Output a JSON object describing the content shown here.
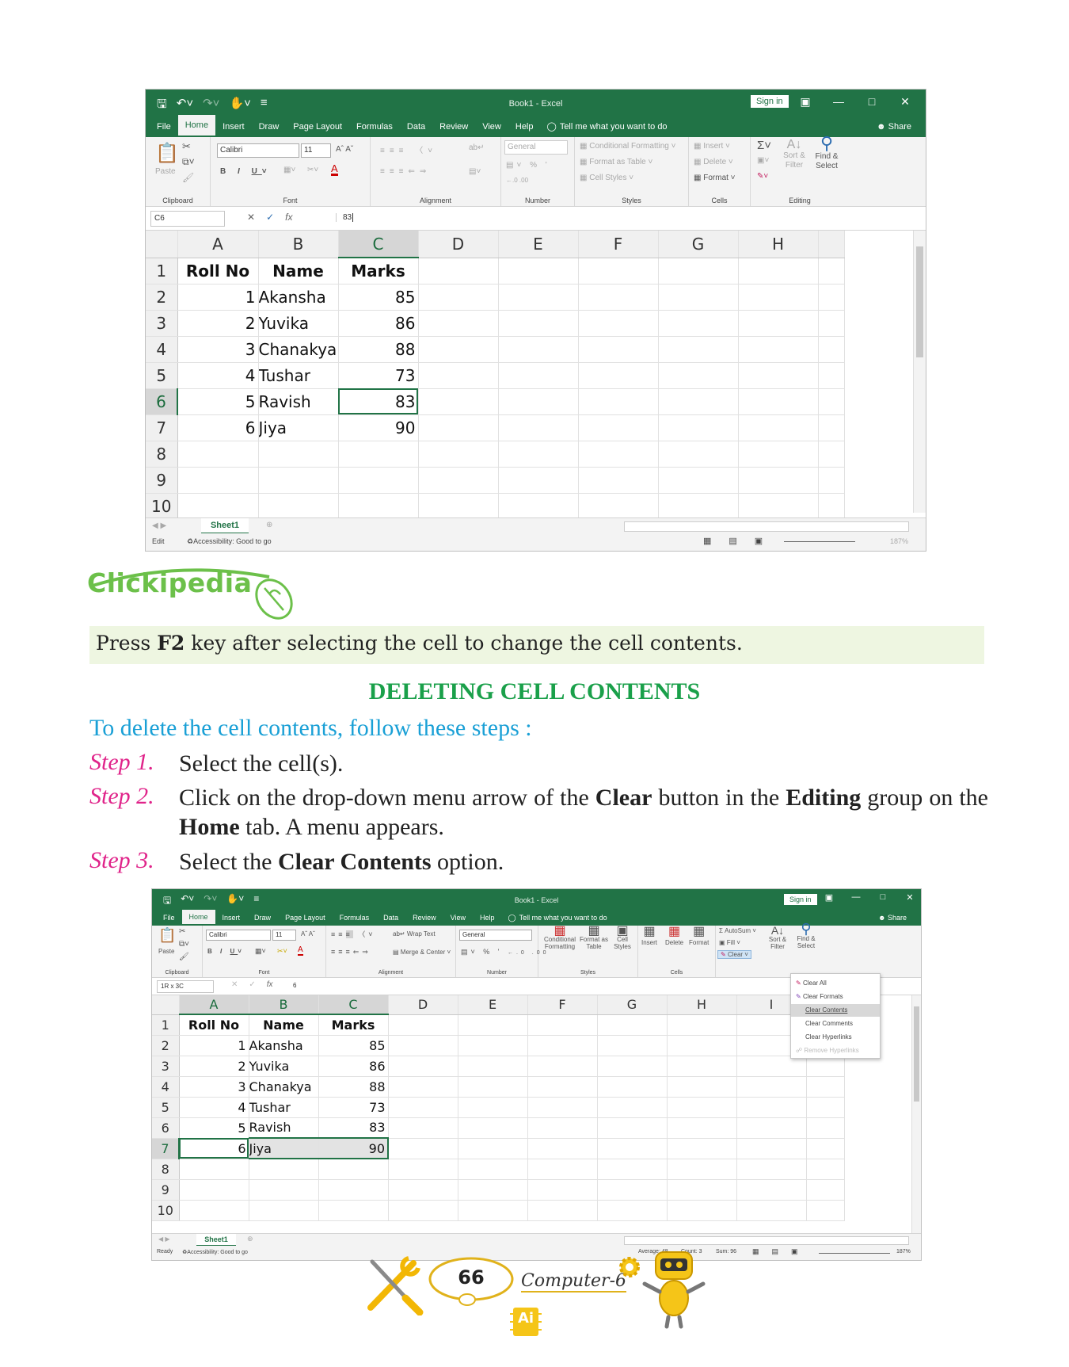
{
  "excel1": {
    "qat_icons": [
      "save-icon",
      "undo-icon",
      "redo-icon",
      "touch-icon",
      "customize-icon"
    ],
    "title": "Book1  -  Excel",
    "sign_in": "Sign in",
    "tabs": [
      "File",
      "Home",
      "Insert",
      "Draw",
      "Page Layout",
      "Formulas",
      "Data",
      "Review",
      "View",
      "Help"
    ],
    "active_tab": "Home",
    "tell_me": "Tell me what you want to do",
    "share": "Share",
    "groups": {
      "clipboard": "Clipboard",
      "font": "Font",
      "alignment": "Alignment",
      "number": "Number",
      "styles": "Styles",
      "cells": "Cells",
      "editing": "Editing"
    },
    "paste": "Paste",
    "font_name": "Calibri",
    "font_size": "11",
    "number_format": "General",
    "cond_format": "Conditional Formatting",
    "format_table": "Format as Table",
    "cell_styles": "Cell Styles",
    "insert": "Insert",
    "delete": "Delete",
    "format": "Format",
    "sort_filter": "Sort & Filter",
    "find_select": "Find & Select",
    "name_box": "C6",
    "formula": "83",
    "columns": [
      "A",
      "B",
      "C",
      "D",
      "E",
      "F",
      "G",
      "H"
    ],
    "rows": [
      {
        "n": "1",
        "a": "Roll No",
        "b": "Name",
        "c": "Marks"
      },
      {
        "n": "2",
        "a": "1",
        "b": "Akansha",
        "c": "85"
      },
      {
        "n": "3",
        "a": "2",
        "b": "Yuvika",
        "c": "86"
      },
      {
        "n": "4",
        "a": "3",
        "b": "Chanakya",
        "c": "88"
      },
      {
        "n": "5",
        "a": "4",
        "b": "Tushar",
        "c": "73"
      },
      {
        "n": "6",
        "a": "5",
        "b": "Ravish",
        "c": "83"
      },
      {
        "n": "7",
        "a": "6",
        "b": "Jiya",
        "c": "90"
      },
      {
        "n": "8",
        "a": "",
        "b": "",
        "c": ""
      },
      {
        "n": "9",
        "a": "",
        "b": "",
        "c": ""
      },
      {
        "n": "10",
        "a": "",
        "b": "",
        "c": ""
      }
    ],
    "sheet": "Sheet1",
    "status_mode": "Edit",
    "accessibility": "Accessibility: Good to go",
    "zoom": "187%"
  },
  "clickipedia": {
    "title": "Clickipedia",
    "text_pre": "Press ",
    "text_key": "F2",
    "text_post": " key after selecting the cell to change the cell contents."
  },
  "section": {
    "heading": "DELETING CELL CONTENTS",
    "intro": "To delete the cell contents, follow these steps :",
    "steps": [
      {
        "label": "Step 1.",
        "parts": [
          "Select the cell(s)."
        ]
      },
      {
        "label": "Step 2.",
        "parts": [
          "Click on the drop-down menu arrow of the ",
          "Clear",
          " button in the ",
          "Editing",
          " group on the ",
          "Home",
          " tab. A menu appears."
        ]
      },
      {
        "label": "Step 3.",
        "parts": [
          "Select the ",
          "Clear Contents",
          " option."
        ]
      }
    ]
  },
  "excel2": {
    "title": "Book1  -  Excel",
    "sign_in": "Sign in",
    "tabs": [
      "File",
      "Home",
      "Insert",
      "Draw",
      "Page Layout",
      "Formulas",
      "Data",
      "Review",
      "View",
      "Help"
    ],
    "tell_me": "Tell me what you want to do",
    "share": "Share",
    "groups": {
      "clipboard": "Clipboard",
      "font": "Font",
      "alignment": "Alignment",
      "number": "Number",
      "styles": "Styles",
      "cells": "Cells"
    },
    "paste": "Paste",
    "font_name": "Calibri",
    "font_size": "11",
    "wrap_text": "Wrap Text",
    "merge_center": "Merge & Center",
    "number_format": "General",
    "cond_format": "Conditional Formatting",
    "format_table": "Format as Table",
    "cell_styles": "Cell Styles",
    "insert": "Insert",
    "delete": "Delete",
    "format": "Format",
    "autosum": "AutoSum",
    "fill": "Fill",
    "clear": "Clear",
    "sort_filter": "Sort & Filter",
    "find_select": "Find & Select",
    "clear_menu": [
      "Clear All",
      "Clear Formats",
      "Clear Contents",
      "Clear Comments",
      "Clear Hyperlinks",
      "Remove Hyperlinks"
    ],
    "name_box": "1R x 3C",
    "formula": "6",
    "columns": [
      "A",
      "B",
      "C",
      "D",
      "E",
      "F",
      "G",
      "H",
      "I",
      "J"
    ],
    "rows": [
      {
        "n": "1",
        "a": "Roll No",
        "b": "Name",
        "c": "Marks"
      },
      {
        "n": "2",
        "a": "1",
        "b": "Akansha",
        "c": "85"
      },
      {
        "n": "3",
        "a": "2",
        "b": "Yuvika",
        "c": "86"
      },
      {
        "n": "4",
        "a": "3",
        "b": "Chanakya",
        "c": "88"
      },
      {
        "n": "5",
        "a": "4",
        "b": "Tushar",
        "c": "73"
      },
      {
        "n": "6",
        "a": "5",
        "b": "Ravish",
        "c": "83"
      },
      {
        "n": "7",
        "a": "6",
        "b": "Jiya",
        "c": "90"
      },
      {
        "n": "8",
        "a": "",
        "b": "",
        "c": ""
      },
      {
        "n": "9",
        "a": "",
        "b": "",
        "c": ""
      },
      {
        "n": "10",
        "a": "",
        "b": "",
        "c": ""
      }
    ],
    "sheet": "Sheet1",
    "status_mode": "Ready",
    "accessibility": "Accessibility: Good to go",
    "average": "Average: 48",
    "count": "Count: 3",
    "sum": "Sum: 96",
    "zoom": "187%"
  },
  "footer": {
    "page": "66",
    "book": "Computer-6",
    "badge": "Ai"
  },
  "colors": {
    "excel_green": "#217346",
    "clickipedia": "#6cc04a",
    "heading": "#1aa04a",
    "intro": "#1aa0d6",
    "step_label": "#e0248a"
  }
}
